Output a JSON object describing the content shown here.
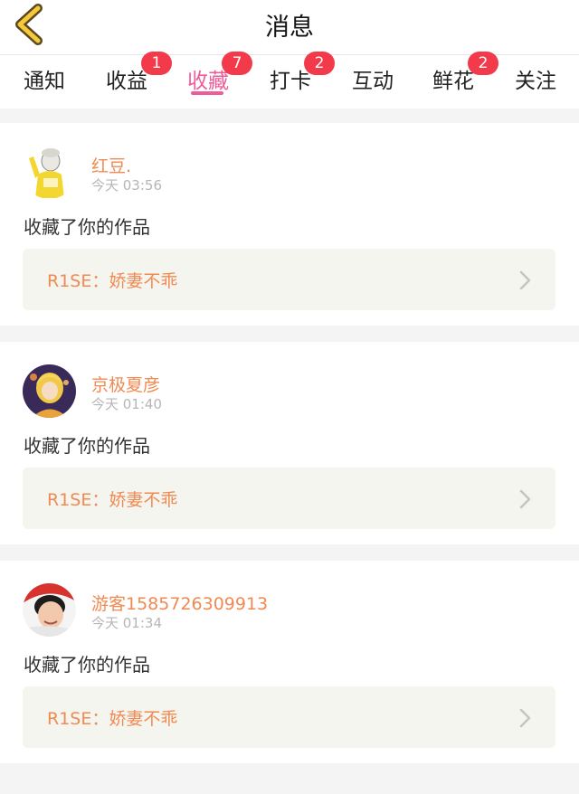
{
  "header": {
    "title": "消息"
  },
  "tabs": [
    {
      "label": "通知",
      "badge": ""
    },
    {
      "label": "收益",
      "badge": "1"
    },
    {
      "label": "收藏",
      "badge": "7",
      "active": true
    },
    {
      "label": "打卡",
      "badge": "2"
    },
    {
      "label": "互动",
      "badge": ""
    },
    {
      "label": "鲜花",
      "badge": "2"
    },
    {
      "label": "关注",
      "badge": ""
    }
  ],
  "messages": [
    {
      "user": "红豆.",
      "time": "今天 03:56",
      "action": "收藏了你的作品",
      "work": "R1SE：娇妻不乖"
    },
    {
      "user": "京极夏彦",
      "time": "今天 01:40",
      "action": "收藏了你的作品",
      "work": "R1SE：娇妻不乖"
    },
    {
      "user": "游客1585726309913",
      "time": "今天 01:34",
      "action": "收藏了你的作品",
      "work": "R1SE：娇妻不乖"
    }
  ],
  "colors": {
    "accent": "#ef5c9a",
    "username": "#f08a52",
    "badge": "#f23a4b"
  }
}
